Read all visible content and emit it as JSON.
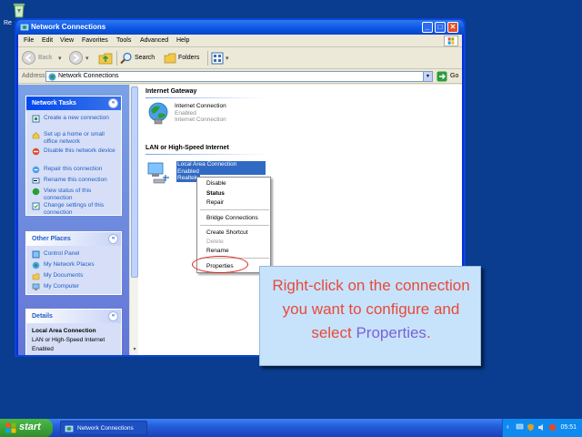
{
  "desktop": {
    "recycle_label": "Re"
  },
  "window": {
    "title": "Network Connections"
  },
  "menubar": {
    "items": [
      "File",
      "Edit",
      "View",
      "Favorites",
      "Tools",
      "Advanced",
      "Help"
    ]
  },
  "toolbar": {
    "back_label": "Back",
    "search_label": "Search",
    "folders_label": "Folders"
  },
  "address": {
    "label": "Address",
    "value": "Network Connections",
    "go_label": "Go"
  },
  "network_tasks": {
    "title": "Network Tasks",
    "items": [
      "Create a new connection",
      "Set up a home or small office network",
      "Disable this network device",
      "Repair this connection",
      "Rename this connection",
      "View status of this connection",
      "Change settings of this connection"
    ]
  },
  "other_places": {
    "title": "Other Places",
    "items": [
      "Control Panel",
      "My Network Places",
      "My Documents",
      "My Computer"
    ]
  },
  "details": {
    "title": "Details",
    "name": "Local Area Connection",
    "type": "LAN or High-Speed Internet",
    "status": "Enabled"
  },
  "groups": {
    "gateway_title": "Internet Gateway",
    "lan_title": "LAN or High-Speed Internet"
  },
  "gateway_item": {
    "name": "Internet Connection",
    "status": "Enabled",
    "type": "Internet Connection"
  },
  "lan_item": {
    "name": "Local Area Connection",
    "status": "Enabled",
    "device": "Realtek"
  },
  "context_menu": {
    "disable": "Disable",
    "status": "Status",
    "repair": "Repair",
    "bridge": "Bridge Connections",
    "shortcut": "Create Shortcut",
    "delete": "Delete",
    "rename": "Rename",
    "properties": "Properties"
  },
  "callout": {
    "text_main": "Right-click on the connection you want to configure and select ",
    "text_em": "Properties",
    "text_end": "."
  },
  "taskbar": {
    "start_label": "start",
    "task_label": "Network Connections",
    "clock": "05:51"
  },
  "colors": {
    "desktop": "#0a3c8f",
    "callout_bg": "#c6e3fb",
    "callout_text": "#e84a3a",
    "callout_emphasis": "#7c61d6",
    "highlight_ring": "#e0201a",
    "selection": "#316ac5"
  }
}
